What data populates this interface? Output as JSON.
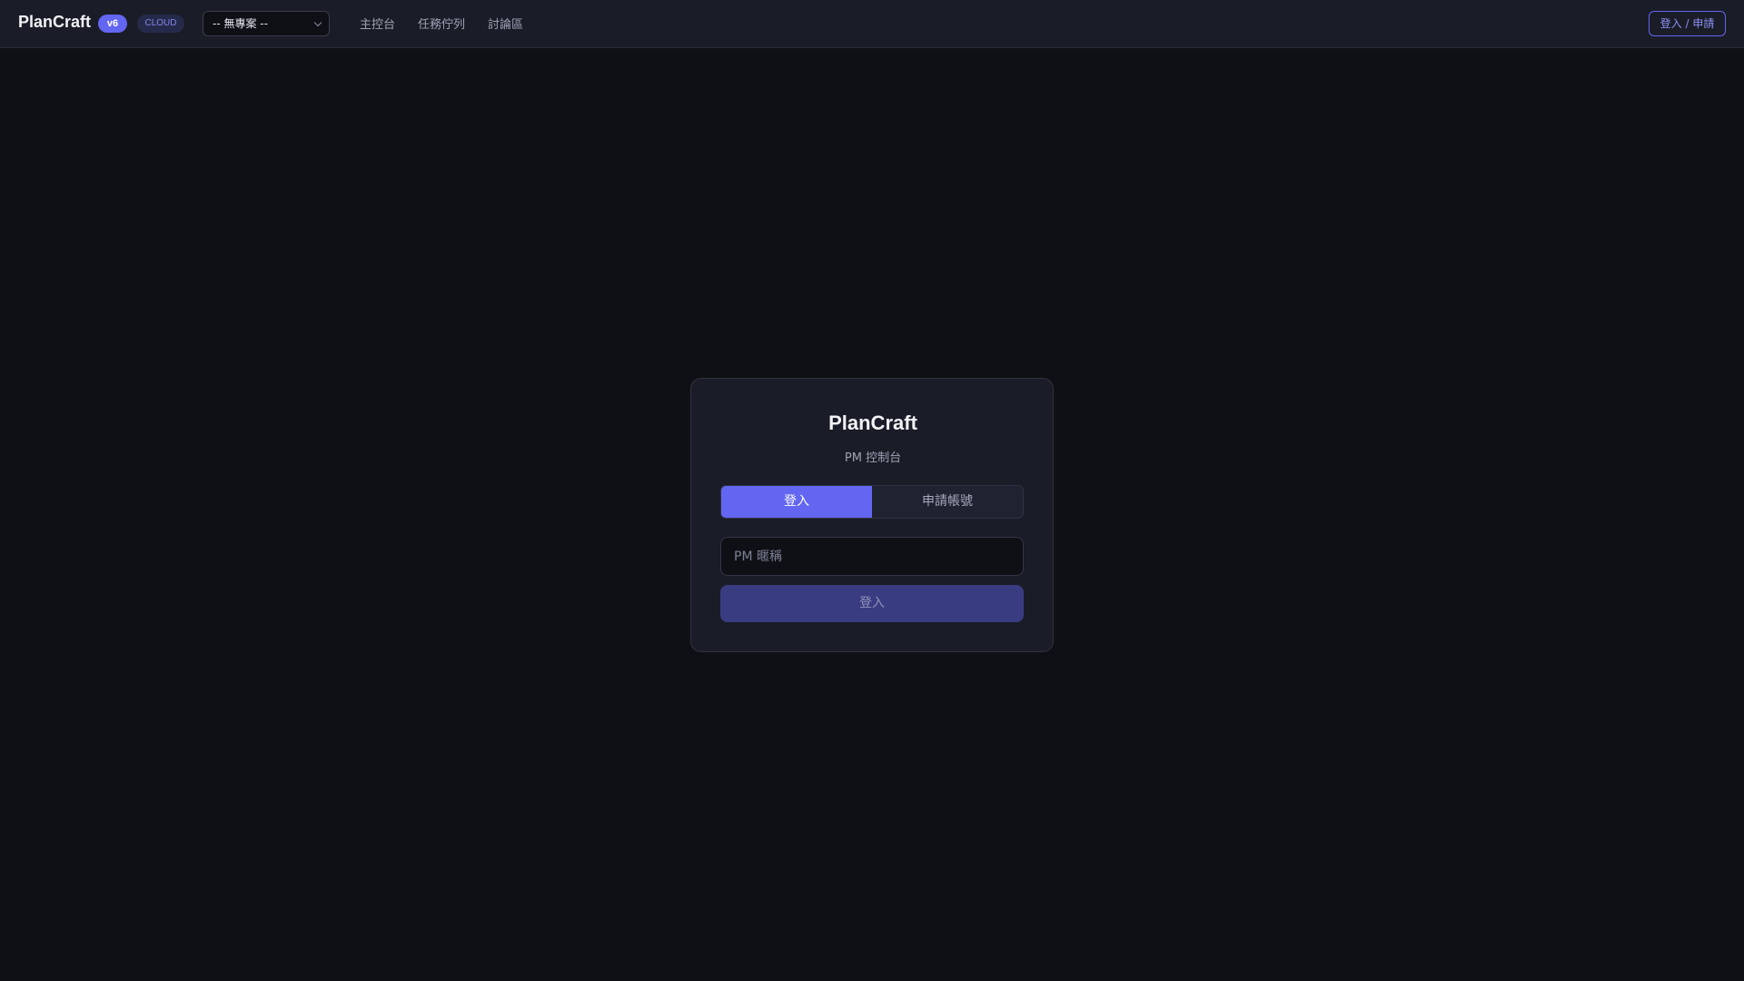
{
  "header": {
    "brand": "PlanCraft",
    "version_badge": "v6",
    "env_badge": "CLOUD",
    "project_select": {
      "selected": "-- 無專案 --"
    },
    "nav": [
      "主控台",
      "任務佇列",
      "討論區"
    ],
    "login_button": "登入 / 申請"
  },
  "login_card": {
    "title": "PlanCraft",
    "subtitle": "PM 控制台",
    "tabs": [
      {
        "label": "登入",
        "active": true
      },
      {
        "label": "申請帳號",
        "active": false
      }
    ],
    "nickname_placeholder": "PM 暱稱",
    "submit_label": "登入"
  },
  "colors": {
    "accent": "#6366f1",
    "background": "#0f1015",
    "surface": "#1a1c27",
    "submit_disabled": "#393c80"
  }
}
